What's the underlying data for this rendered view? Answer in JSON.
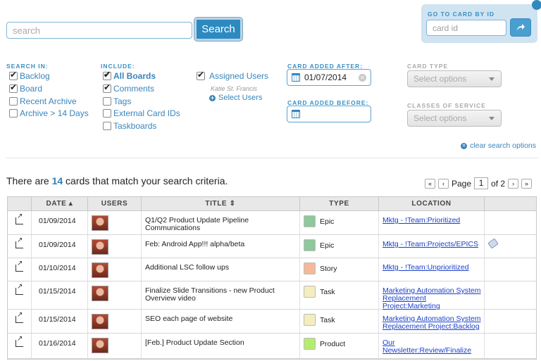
{
  "search": {
    "placeholder": "search",
    "button": "Search"
  },
  "goto": {
    "title": "GO TO CARD BY ID",
    "placeholder": "card id"
  },
  "search_in": {
    "title": "SEARCH IN:",
    "items": [
      {
        "label": "Backlog",
        "checked": true
      },
      {
        "label": "Board",
        "checked": true
      },
      {
        "label": "Recent Archive",
        "checked": false
      },
      {
        "label": "Archive > 14 Days",
        "checked": false
      }
    ]
  },
  "include": {
    "title": "INCLUDE:",
    "items": [
      {
        "label": "All Boards",
        "checked": true
      },
      {
        "label": "Comments",
        "checked": true
      },
      {
        "label": "Tags",
        "checked": false
      },
      {
        "label": "External Card IDs",
        "checked": false
      },
      {
        "label": "Taskboards",
        "checked": false
      }
    ]
  },
  "assigned": {
    "label": "Assigned Users",
    "user": "Katie St. Francis",
    "select": "Select Users"
  },
  "card_added_after": {
    "title": "CARD ADDED AFTER:",
    "value": "01/07/2014"
  },
  "card_added_before": {
    "title": "CARD ADDED BEFORE:",
    "value": ""
  },
  "card_type": {
    "title": "CARD TYPE",
    "placeholder": "Select options"
  },
  "classes": {
    "title": "CLASSES OF SERVICE",
    "placeholder": "Select options"
  },
  "clear_search": "clear search options",
  "results": {
    "prefix": "There are ",
    "count": "14",
    "suffix": " cards that match your search criteria."
  },
  "pager": {
    "first": "«",
    "prev": "‹",
    "label": "Page",
    "page": "1",
    "of": "of 2",
    "next": "›",
    "last": "»"
  },
  "table": {
    "headers": {
      "date": "DATE ▴",
      "users": "USERS",
      "title": "TITLE ⇕",
      "type": "TYPE",
      "location": "LOCATION"
    },
    "rows": [
      {
        "date": "01/09/2014",
        "title": "Q1/Q2 Product Update Pipeline Communications",
        "type": "Epic",
        "color": "#8fc89a",
        "location": "Mktg - !Team:Prioritized"
      },
      {
        "date": "01/09/2014",
        "title": "Feb: Android App!!! alpha/beta",
        "type": "Epic",
        "color": "#8fc89a",
        "location": "Mktg - !Team:Projects/EPICS"
      },
      {
        "date": "01/10/2014",
        "title": "Additional LSC follow ups",
        "type": "Story",
        "color": "#f5b898",
        "location": "Mktg - !Team:Unprioritized"
      },
      {
        "date": "01/15/2014",
        "title": "Finalize Slide Transitions - new Product Overview video",
        "type": "Task",
        "color": "#f3eec0",
        "location": "Marketing Automation System Replacement Project:Marketing"
      },
      {
        "date": "01/15/2014",
        "title": "SEO each page of website",
        "type": "Task",
        "color": "#f3eec0",
        "location": "Marketing Automation System Replacement Project:Backlog"
      },
      {
        "date": "01/16/2014",
        "title": "[Feb.] Product Update Section",
        "type": "Product",
        "color": "#b5ec70",
        "location": "Our Newsletter:Review/Finalize"
      }
    ]
  }
}
